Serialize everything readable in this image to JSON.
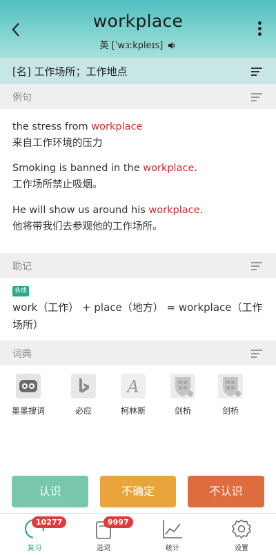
{
  "header": {
    "word": "workplace",
    "phonetic_prefix": "英 [ˈ",
    "phonetic_body": "wɜːkpleɪs]"
  },
  "definition": "[名] 工作场所；工作地点",
  "sections": {
    "examples": "例句",
    "mnemonic": "助记",
    "dictionaries": "词典"
  },
  "examples": [
    {
      "en_before": "the stress from ",
      "en_hl": "workplace",
      "en_after": "",
      "zh": "来自工作环境的压力"
    },
    {
      "en_before": "Smoking is banned in the ",
      "en_hl": "workplace",
      "en_after": ".",
      "zh": "工作场所禁止吸烟。"
    },
    {
      "en_before": "He will show us around his ",
      "en_hl": "workplace",
      "en_after": ".",
      "zh": "他将带我们去参观他的工作场所。"
    }
  ],
  "mnemonic": {
    "badge": "合成",
    "text": "work（工作） + place（地方） = workplace（工作场所）"
  },
  "dictionaries": [
    "墨墨搜词",
    "必应",
    "柯林斯",
    "剑桥",
    "剑桥"
  ],
  "actions": {
    "know": "认识",
    "unsure": "不确定",
    "unknown": "不认识"
  },
  "tabs": [
    {
      "label": "复习",
      "count": "10277"
    },
    {
      "label": "选词",
      "count": "9997"
    },
    {
      "label": "统计",
      "count": ""
    },
    {
      "label": "设置",
      "count": ""
    }
  ],
  "colors": {
    "header_top": "#4fbfbf",
    "definition_bar": "#c8e6e6",
    "highlight": "#d42a2a",
    "know": "#79c7ad",
    "unsure": "#e9a53c",
    "unknown": "#de6c3f",
    "badge": "#e23b3b",
    "active_tab": "#2aa888"
  }
}
